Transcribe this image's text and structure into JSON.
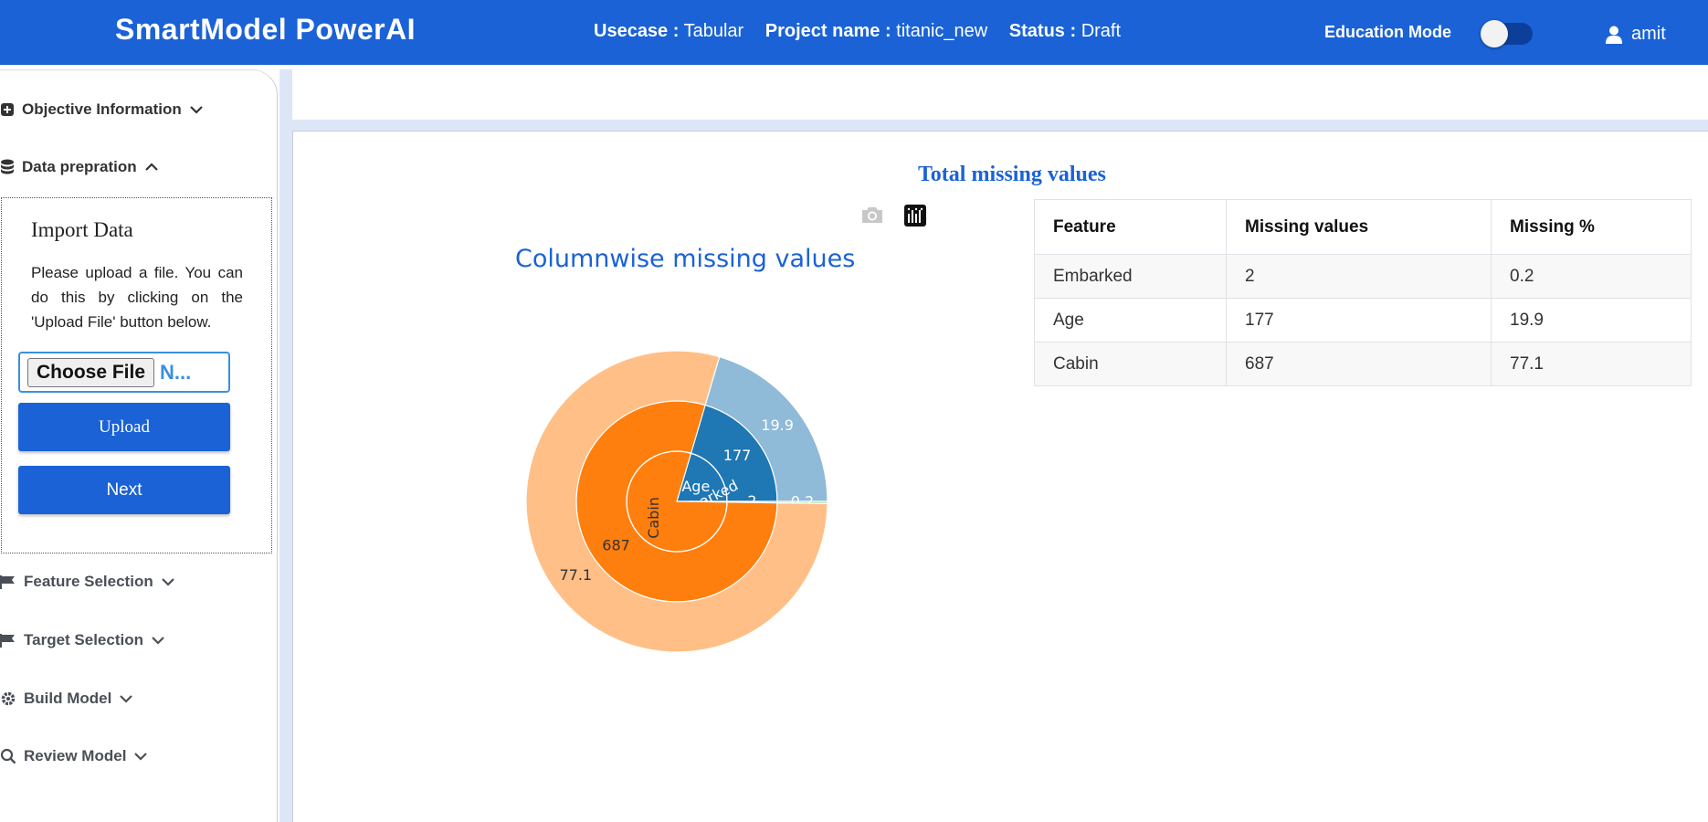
{
  "header": {
    "brand": "SmartModel PowerAI",
    "usecase_label": "Usecase :",
    "usecase_value": "Tabular",
    "project_label": "Project name :",
    "project_value": "titanic_new",
    "status_label": "Status :",
    "status_value": "Draft",
    "education_mode_label": "Education Mode",
    "education_mode_on": false,
    "user_name": "amit",
    "color": "#1a62d6"
  },
  "sidebar": {
    "objective": "Objective Information",
    "data_prep": "Data prepration",
    "feature_selection": "Feature Selection",
    "target_selection": "Target Selection",
    "build_model": "Build Model",
    "review_model": "Review Model"
  },
  "import_panel": {
    "title": "Import Data",
    "instructions": "Please upload a file. You can do this by clicking on the 'Upload File' button below.",
    "choose_file_label": "Choose File",
    "file_name": "N...",
    "upload_label": "Upload",
    "next_label": "Next"
  },
  "main": {
    "section_title": "Total missing values",
    "chart_title": "Columnwise missing values",
    "table": {
      "headers": [
        "Feature",
        "Missing values",
        "Missing %"
      ],
      "rows": [
        [
          "Embarked",
          "2",
          "0.2"
        ],
        [
          "Age",
          "177",
          "19.9"
        ],
        [
          "Cabin",
          "687",
          "77.1"
        ]
      ]
    }
  },
  "chart_data": {
    "type": "sunburst",
    "title": "Columnwise missing values",
    "segments": [
      {
        "name": "Age",
        "count": 177,
        "percent": 19.9,
        "color": "#1f77b4",
        "outer_color": "#8fbad8"
      },
      {
        "name": "Embarked",
        "count": 2,
        "percent": 0.2,
        "color": "#2ca02c",
        "outer_color": "#96d094"
      },
      {
        "name": "Cabin",
        "count": 687,
        "percent": 77.1,
        "color": "#ff7f0e",
        "outer_color": "#ffbf86"
      }
    ]
  }
}
